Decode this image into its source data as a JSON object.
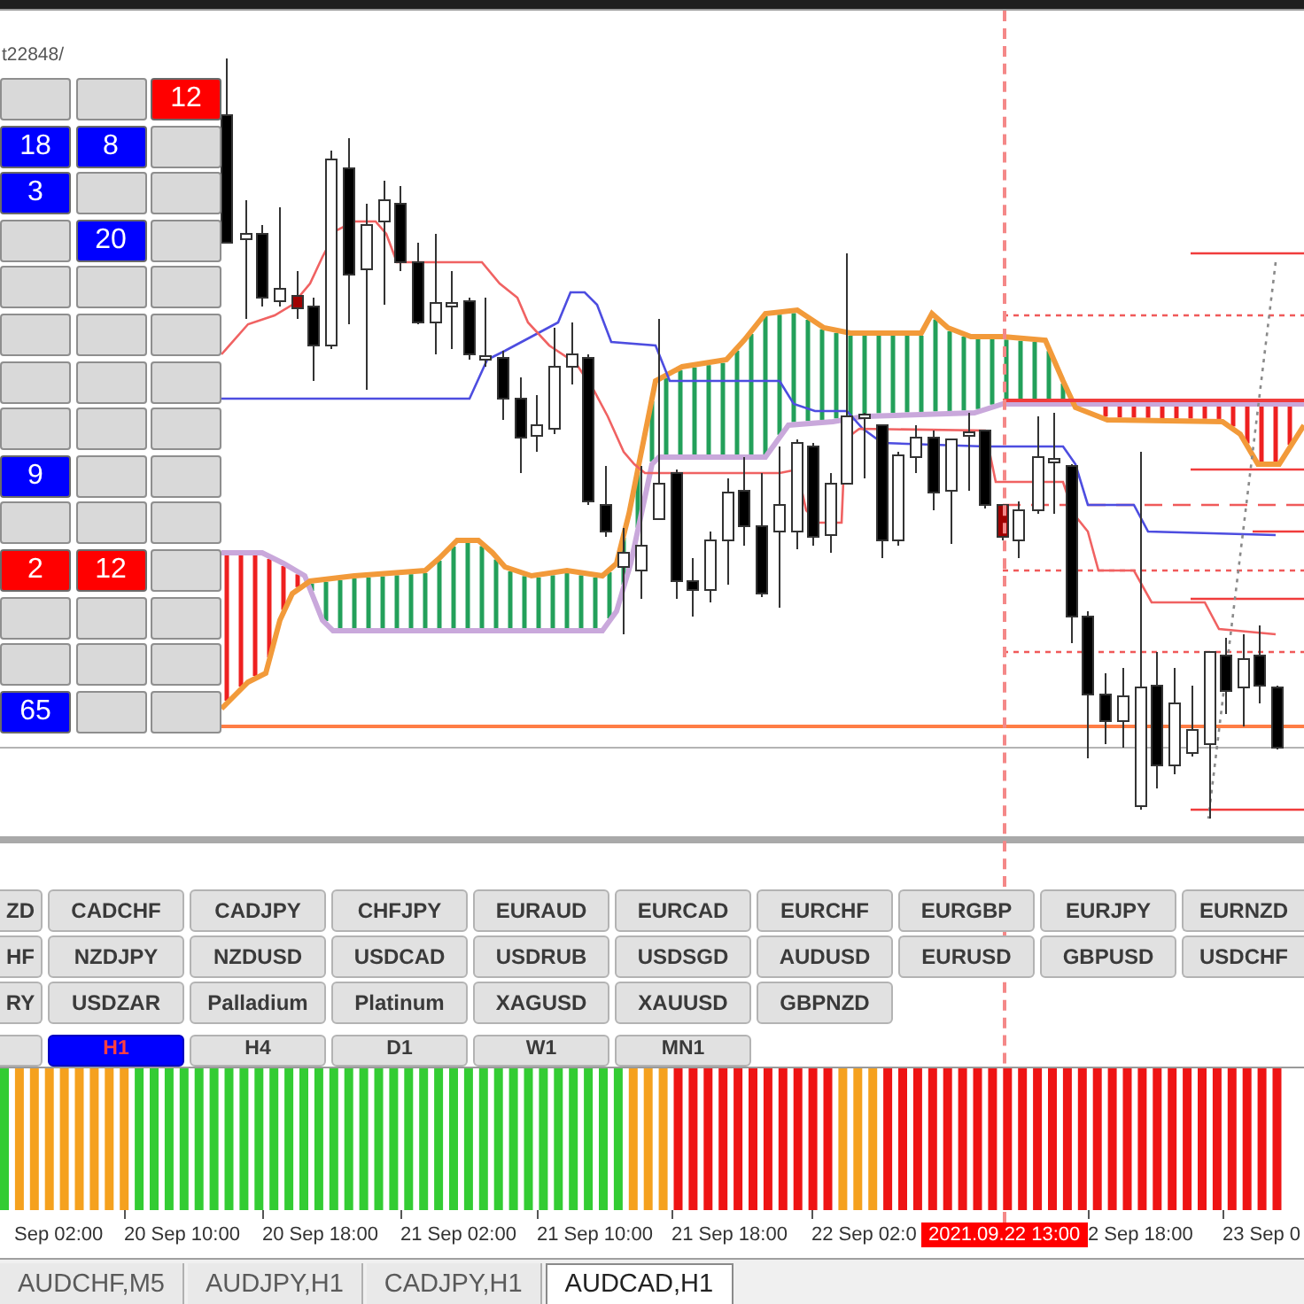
{
  "chart": {
    "comment": "t22848/"
  },
  "signal_grid": {
    "rows": [
      [
        {
          "kind": "blank"
        },
        {
          "kind": "blank"
        },
        {
          "kind": "count",
          "value": "12",
          "color": "#ff0000"
        }
      ],
      [
        {
          "kind": "count",
          "value": "18",
          "color": "#0000ff"
        },
        {
          "kind": "count",
          "value": "8",
          "color": "#0000ff"
        },
        {
          "kind": "blank"
        }
      ],
      [
        {
          "kind": "count",
          "value": "3",
          "color": "#0000ff"
        },
        {
          "kind": "blank"
        },
        {
          "kind": "blank"
        }
      ],
      [
        {
          "kind": "blank"
        },
        {
          "kind": "count",
          "value": "20",
          "color": "#0000ff"
        },
        {
          "kind": "blank"
        }
      ],
      [
        {
          "kind": "blank"
        },
        {
          "kind": "blank"
        },
        {
          "kind": "blank"
        }
      ],
      [
        {
          "kind": "blank"
        },
        {
          "kind": "blank"
        },
        {
          "kind": "blank"
        }
      ],
      [
        {
          "kind": "blank"
        },
        {
          "kind": "blank"
        },
        {
          "kind": "blank"
        }
      ],
      [
        {
          "kind": "blank"
        },
        {
          "kind": "blank"
        },
        {
          "kind": "blank"
        }
      ],
      [
        {
          "kind": "count",
          "value": "9",
          "color": "#0000ff"
        },
        {
          "kind": "blank"
        },
        {
          "kind": "blank"
        }
      ],
      [
        {
          "kind": "blank"
        },
        {
          "kind": "blank"
        },
        {
          "kind": "blank"
        }
      ],
      [
        {
          "kind": "count",
          "value": "2",
          "color": "#ff0000"
        },
        {
          "kind": "count",
          "value": "12",
          "color": "#ff0000"
        },
        {
          "kind": "blank"
        }
      ],
      [
        {
          "kind": "blank"
        },
        {
          "kind": "blank"
        },
        {
          "kind": "blank"
        }
      ],
      [
        {
          "kind": "blank"
        },
        {
          "kind": "blank"
        },
        {
          "kind": "blank"
        }
      ],
      [
        {
          "kind": "count",
          "value": "65",
          "color": "#0000ff"
        },
        {
          "kind": "blank"
        },
        {
          "kind": "blank"
        }
      ]
    ]
  },
  "symbol_buttons": {
    "rows": [
      [
        "ZD",
        "CADCHF",
        "CADJPY",
        "CHFJPY",
        "EURAUD",
        "EURCAD",
        "EURCHF",
        "EURGBP",
        "EURJPY",
        "EURNZD"
      ],
      [
        "HF",
        "NZDJPY",
        "NZDUSD",
        "USDCAD",
        "USDRUB",
        "USDSGD",
        "AUDUSD",
        "EURUSD",
        "GBPUSD",
        "USDCHF"
      ],
      [
        "RY",
        "USDZAR",
        "Palladium",
        "Platinum",
        "XAGUSD",
        "XAUUSD",
        "GBPNZD"
      ]
    ]
  },
  "timeframe_buttons": [
    {
      "selected": false
    },
    {
      "label": "H1",
      "selected": true
    },
    {
      "label": "H4",
      "selected": false
    },
    {
      "label": "D1",
      "selected": false
    },
    {
      "label": "W1",
      "selected": false
    },
    {
      "label": "MN1",
      "selected": false
    }
  ],
  "time_axis": {
    "labels": [
      {
        "kind": "tick",
        "text": "Sep 02:00"
      },
      {
        "kind": "tick",
        "text": "20 Sep 10:00"
      },
      {
        "kind": "tick",
        "text": "20 Sep 18:00"
      },
      {
        "kind": "tick",
        "text": "21 Sep 02:00"
      },
      {
        "kind": "tick",
        "text": "21 Sep 10:00"
      },
      {
        "kind": "tick",
        "text": "21 Sep 18:00"
      },
      {
        "kind": "tick",
        "text": "22 Sep 02:0"
      },
      {
        "kind": "cursor",
        "text": "2021.09.22 13:00"
      },
      {
        "kind": "tick",
        "text": "2 Sep 18:00"
      },
      {
        "kind": "tick",
        "text": "23 Sep 0"
      }
    ]
  },
  "tabs": [
    {
      "label": "AUDCHF,M5",
      "selected": false
    },
    {
      "label": "AUDJPY,H1",
      "selected": false
    },
    {
      "label": "CADJPY,H1",
      "selected": false
    },
    {
      "label": "AUDCAD,H1",
      "selected": true
    }
  ]
}
